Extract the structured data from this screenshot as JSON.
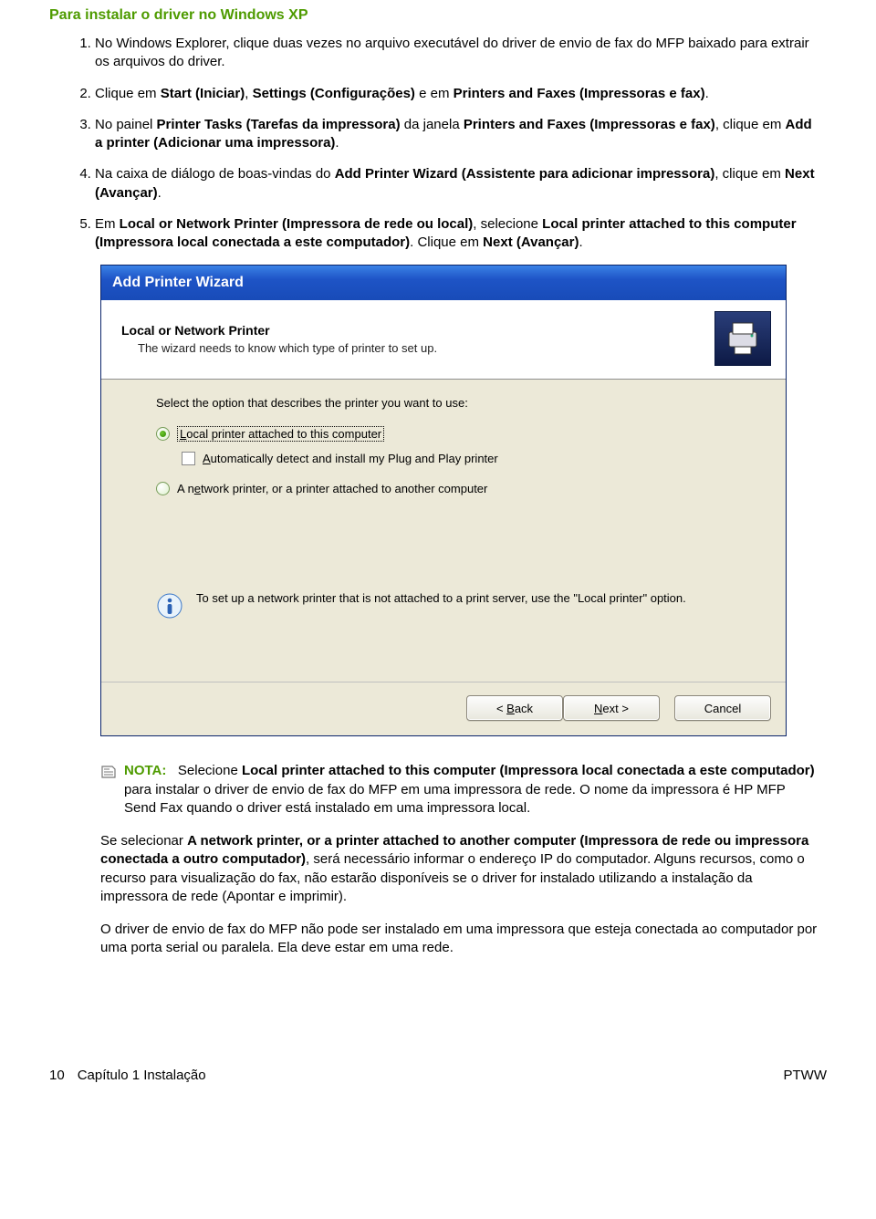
{
  "heading": "Para instalar o driver no Windows XP",
  "steps": {
    "s1": "No Windows Explorer, clique duas vezes no arquivo executável do driver de envio de fax do MFP baixado para extrair os arquivos do driver.",
    "s2_a": "Clique em ",
    "s2_b": "Start (Iniciar)",
    "s2_c": ", ",
    "s2_d": "Settings (Configurações)",
    "s2_e": " e em ",
    "s2_f": "Printers and Faxes (Impressoras e fax)",
    "s2_g": ".",
    "s3_a": "No painel ",
    "s3_b": "Printer Tasks (Tarefas da impressora)",
    "s3_c": " da janela ",
    "s3_d": "Printers and Faxes (Impressoras e fax)",
    "s3_e": ", clique em ",
    "s3_f": "Add a printer (Adicionar uma impressora)",
    "s3_g": ".",
    "s4_a": "Na caixa de diálogo de boas-vindas do ",
    "s4_b": "Add Printer Wizard (Assistente para adicionar impressora)",
    "s4_c": ", clique em ",
    "s4_d": "Next (Avançar)",
    "s4_e": ".",
    "s5_a": "Em ",
    "s5_b": "Local or Network Printer (Impressora de rede ou local)",
    "s5_c": ", selecione ",
    "s5_d": "Local printer attached to this computer (Impressora local conectada a este computador)",
    "s5_e": ". Clique em ",
    "s5_f": "Next (Avançar)",
    "s5_g": "."
  },
  "wizard": {
    "title": "Add Printer Wizard",
    "header_title": "Local or Network Printer",
    "header_sub": "The wizard needs to know which type of printer to set up.",
    "prompt": "Select the option that describes the printer you want to use:",
    "radio1_u": "L",
    "radio1_rest": "ocal printer attached to this computer",
    "check_u": "A",
    "check_rest": "utomatically detect and install my Plug and Play printer",
    "radio2_pre": "A n",
    "radio2_u": "e",
    "radio2_rest": "twork printer, or a printer attached to another computer",
    "info": "To set up a network printer that is not attached to a print server, use the \"Local printer\" option.",
    "btn_back_lt": "<",
    "btn_back_u": "B",
    "btn_back_rest": "ack",
    "btn_next_u": "N",
    "btn_next_rest": "ext >",
    "btn_cancel": "Cancel"
  },
  "note": {
    "label": "NOTA:",
    "p1_a": "Selecione ",
    "p1_b": "Local printer attached to this computer (Impressora local conectada a este computador)",
    "p1_c": " para instalar o driver de envio de fax do MFP em uma impressora de rede. O nome da impressora é HP MFP Send Fax quando o driver está instalado em uma impressora local.",
    "p2_a": "Se selecionar ",
    "p2_b": "A network printer, or a printer attached to another computer (Impressora de rede ou impressora conectada a outro computador)",
    "p2_c": ", será necessário informar o endereço IP do computador. Alguns recursos, como o recurso para visualização do fax, não estarão disponíveis se o driver for instalado utilizando a instalação da impressora de rede (Apontar e imprimir).",
    "p3": "O driver de envio de fax do MFP não pode ser instalado em uma impressora que esteja conectada ao computador por uma porta serial ou paralela. Ela deve estar em uma rede."
  },
  "footer": {
    "pagenum": "10",
    "chapter": "Capítulo 1   Instalação",
    "lang": "PTWW"
  }
}
